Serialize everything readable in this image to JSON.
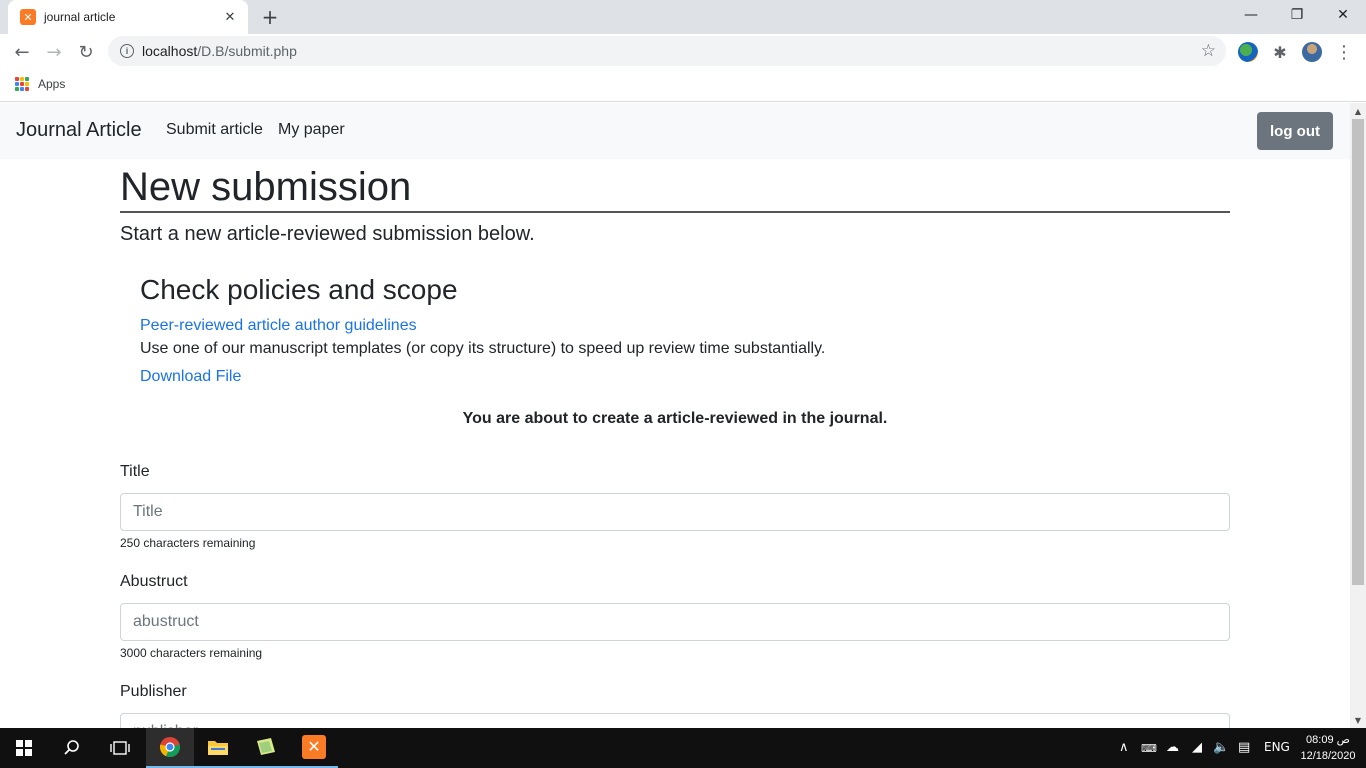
{
  "browser": {
    "tab_title": "journal article",
    "url_host": "localhost",
    "url_path": "/D.B/submit.php",
    "bookmarks_apps_label": "Apps"
  },
  "nav": {
    "brand": "Journal Article",
    "links": [
      "Submit article",
      "My paper"
    ],
    "logout_label": "log out"
  },
  "page": {
    "title": "New submission",
    "lead": "Start a new article-reviewed submission below.",
    "policies_heading": "Check policies and scope",
    "guidelines_link": "Peer-reviewed article author guidelines",
    "templates_text": "Use one of our manuscript templates (or copy its structure) to speed up review time substantially.",
    "download_link": "Download File",
    "notice": "You are about to create a article-reviewed in the journal."
  },
  "form": {
    "title": {
      "label": "Title",
      "placeholder": "Title",
      "value": "",
      "help": "250 characters remaining"
    },
    "abstract": {
      "label": "Abustruct",
      "placeholder": "abustruct",
      "value": "",
      "help": "3000 characters remaining"
    },
    "publisher": {
      "label": "Publisher",
      "placeholder": "publisher",
      "value": ""
    }
  },
  "taskbar": {
    "language": "ENG",
    "time": "08:09 ص",
    "date": "12/18/2020"
  },
  "colors": {
    "link": "#1a73e8",
    "logout_button": "#6c757d",
    "navbar_bg": "#f8f9fa",
    "xampp_orange": "#fb7a24"
  }
}
